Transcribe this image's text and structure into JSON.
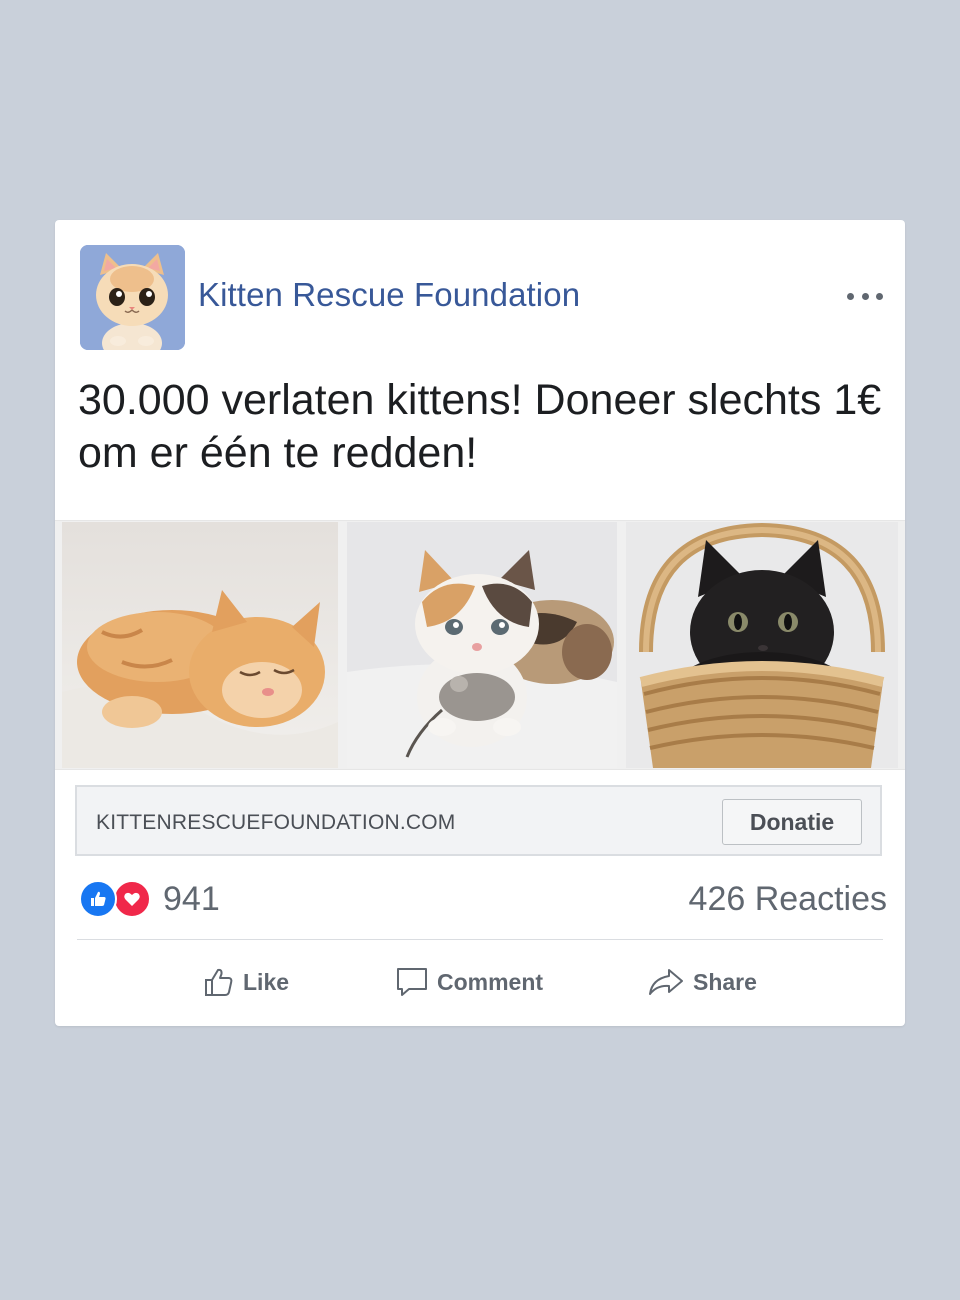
{
  "post": {
    "page_name": "Kitten Rescue Foundation",
    "text": "30.000 verlaten kittens! Doneer slechts 1€ om er één te redden!",
    "avatar_icon": "cartoon-kitten-avatar",
    "more_icon": "more-options-icon"
  },
  "photos": [
    {
      "name": "sleeping-orange-kitten"
    },
    {
      "name": "calico-kitten-with-toy-mouse"
    },
    {
      "name": "black-kitten-in-basket"
    }
  ],
  "link": {
    "domain": "KITTENRESCUEFOUNDATION.COM",
    "button_label": "Donatie"
  },
  "stats": {
    "reaction_count": "941",
    "comments_label": "426 Reacties"
  },
  "actions": {
    "like": "Like",
    "comment": "Comment",
    "share": "Share"
  },
  "colors": {
    "page_background": "#c9d0da",
    "brand_blue": "#385898",
    "like_blue": "#1877f2",
    "love_red": "#f0284a"
  }
}
